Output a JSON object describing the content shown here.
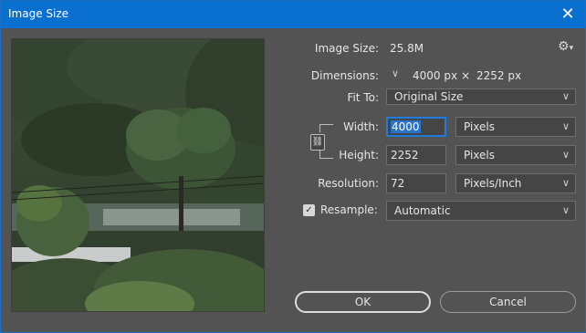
{
  "window": {
    "title": "Image Size",
    "close_glyph": "✕"
  },
  "image_size": {
    "label": "Image Size:",
    "value": "25.8M"
  },
  "dimensions": {
    "label": "Dimensions:",
    "width": "4000 px",
    "times": "×",
    "height": "2252 px"
  },
  "fit_to": {
    "label": "Fit To:",
    "value": "Original Size"
  },
  "width": {
    "label": "Width:",
    "value": "4000",
    "unit": "Pixels"
  },
  "height": {
    "label": "Height:",
    "value": "2252",
    "unit": "Pixels"
  },
  "resolution": {
    "label": "Resolution:",
    "value": "72",
    "unit": "Pixels/Inch"
  },
  "resample": {
    "label": "Resample:",
    "checked": true,
    "value": "Automatic"
  },
  "buttons": {
    "ok": "OK",
    "cancel": "Cancel"
  },
  "icons": {
    "settings": "gear-icon",
    "chain": "link-icon",
    "chevron": "chevron-down-icon"
  },
  "colors": {
    "titlebar": "#0a70d0",
    "background": "#535353",
    "focus": "#1f7bde"
  }
}
